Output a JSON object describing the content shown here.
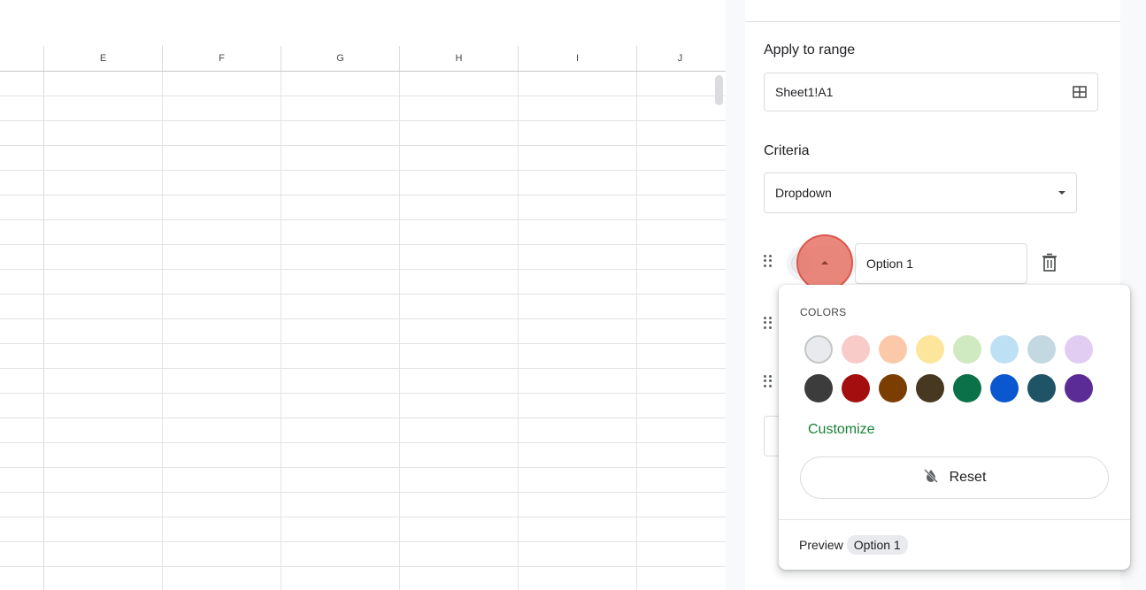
{
  "grid": {
    "columns": [
      "E",
      "F",
      "G",
      "H",
      "I",
      "J"
    ],
    "row_count": 21
  },
  "panel": {
    "apply_range_label": "Apply to range",
    "range_value": "Sheet1!A1",
    "criteria_label": "Criteria",
    "criteria_value": "Dropdown",
    "option_value": "Option 1"
  },
  "color_popup": {
    "section_title": "COLORS",
    "light_colors": [
      "#e8eaed",
      "#f9cbc8",
      "#fbc9a9",
      "#fde59c",
      "#cfe9c1",
      "#bde0f5",
      "#c3d8e0",
      "#e2cdf2"
    ],
    "dark_colors": [
      "#3c3c3c",
      "#a50e0e",
      "#7c3e00",
      "#473821",
      "#0b7148",
      "#0b57d0",
      "#1e5466",
      "#5b2c96"
    ],
    "selected_index": 0,
    "customize_label": "Customize",
    "reset_label": "Reset",
    "preview_label": "Preview",
    "preview_chip": "Option 1"
  },
  "accent": {
    "customize_green": "#188038",
    "click_indicator": "#e66e60"
  },
  "icons": {
    "range": "grid-icon",
    "criteria": "chevron-down-icon",
    "chip": "chevron-up-icon",
    "delete": "trash-icon",
    "reset": "format-color-reset-icon",
    "drag": "drag-handle-icon"
  }
}
